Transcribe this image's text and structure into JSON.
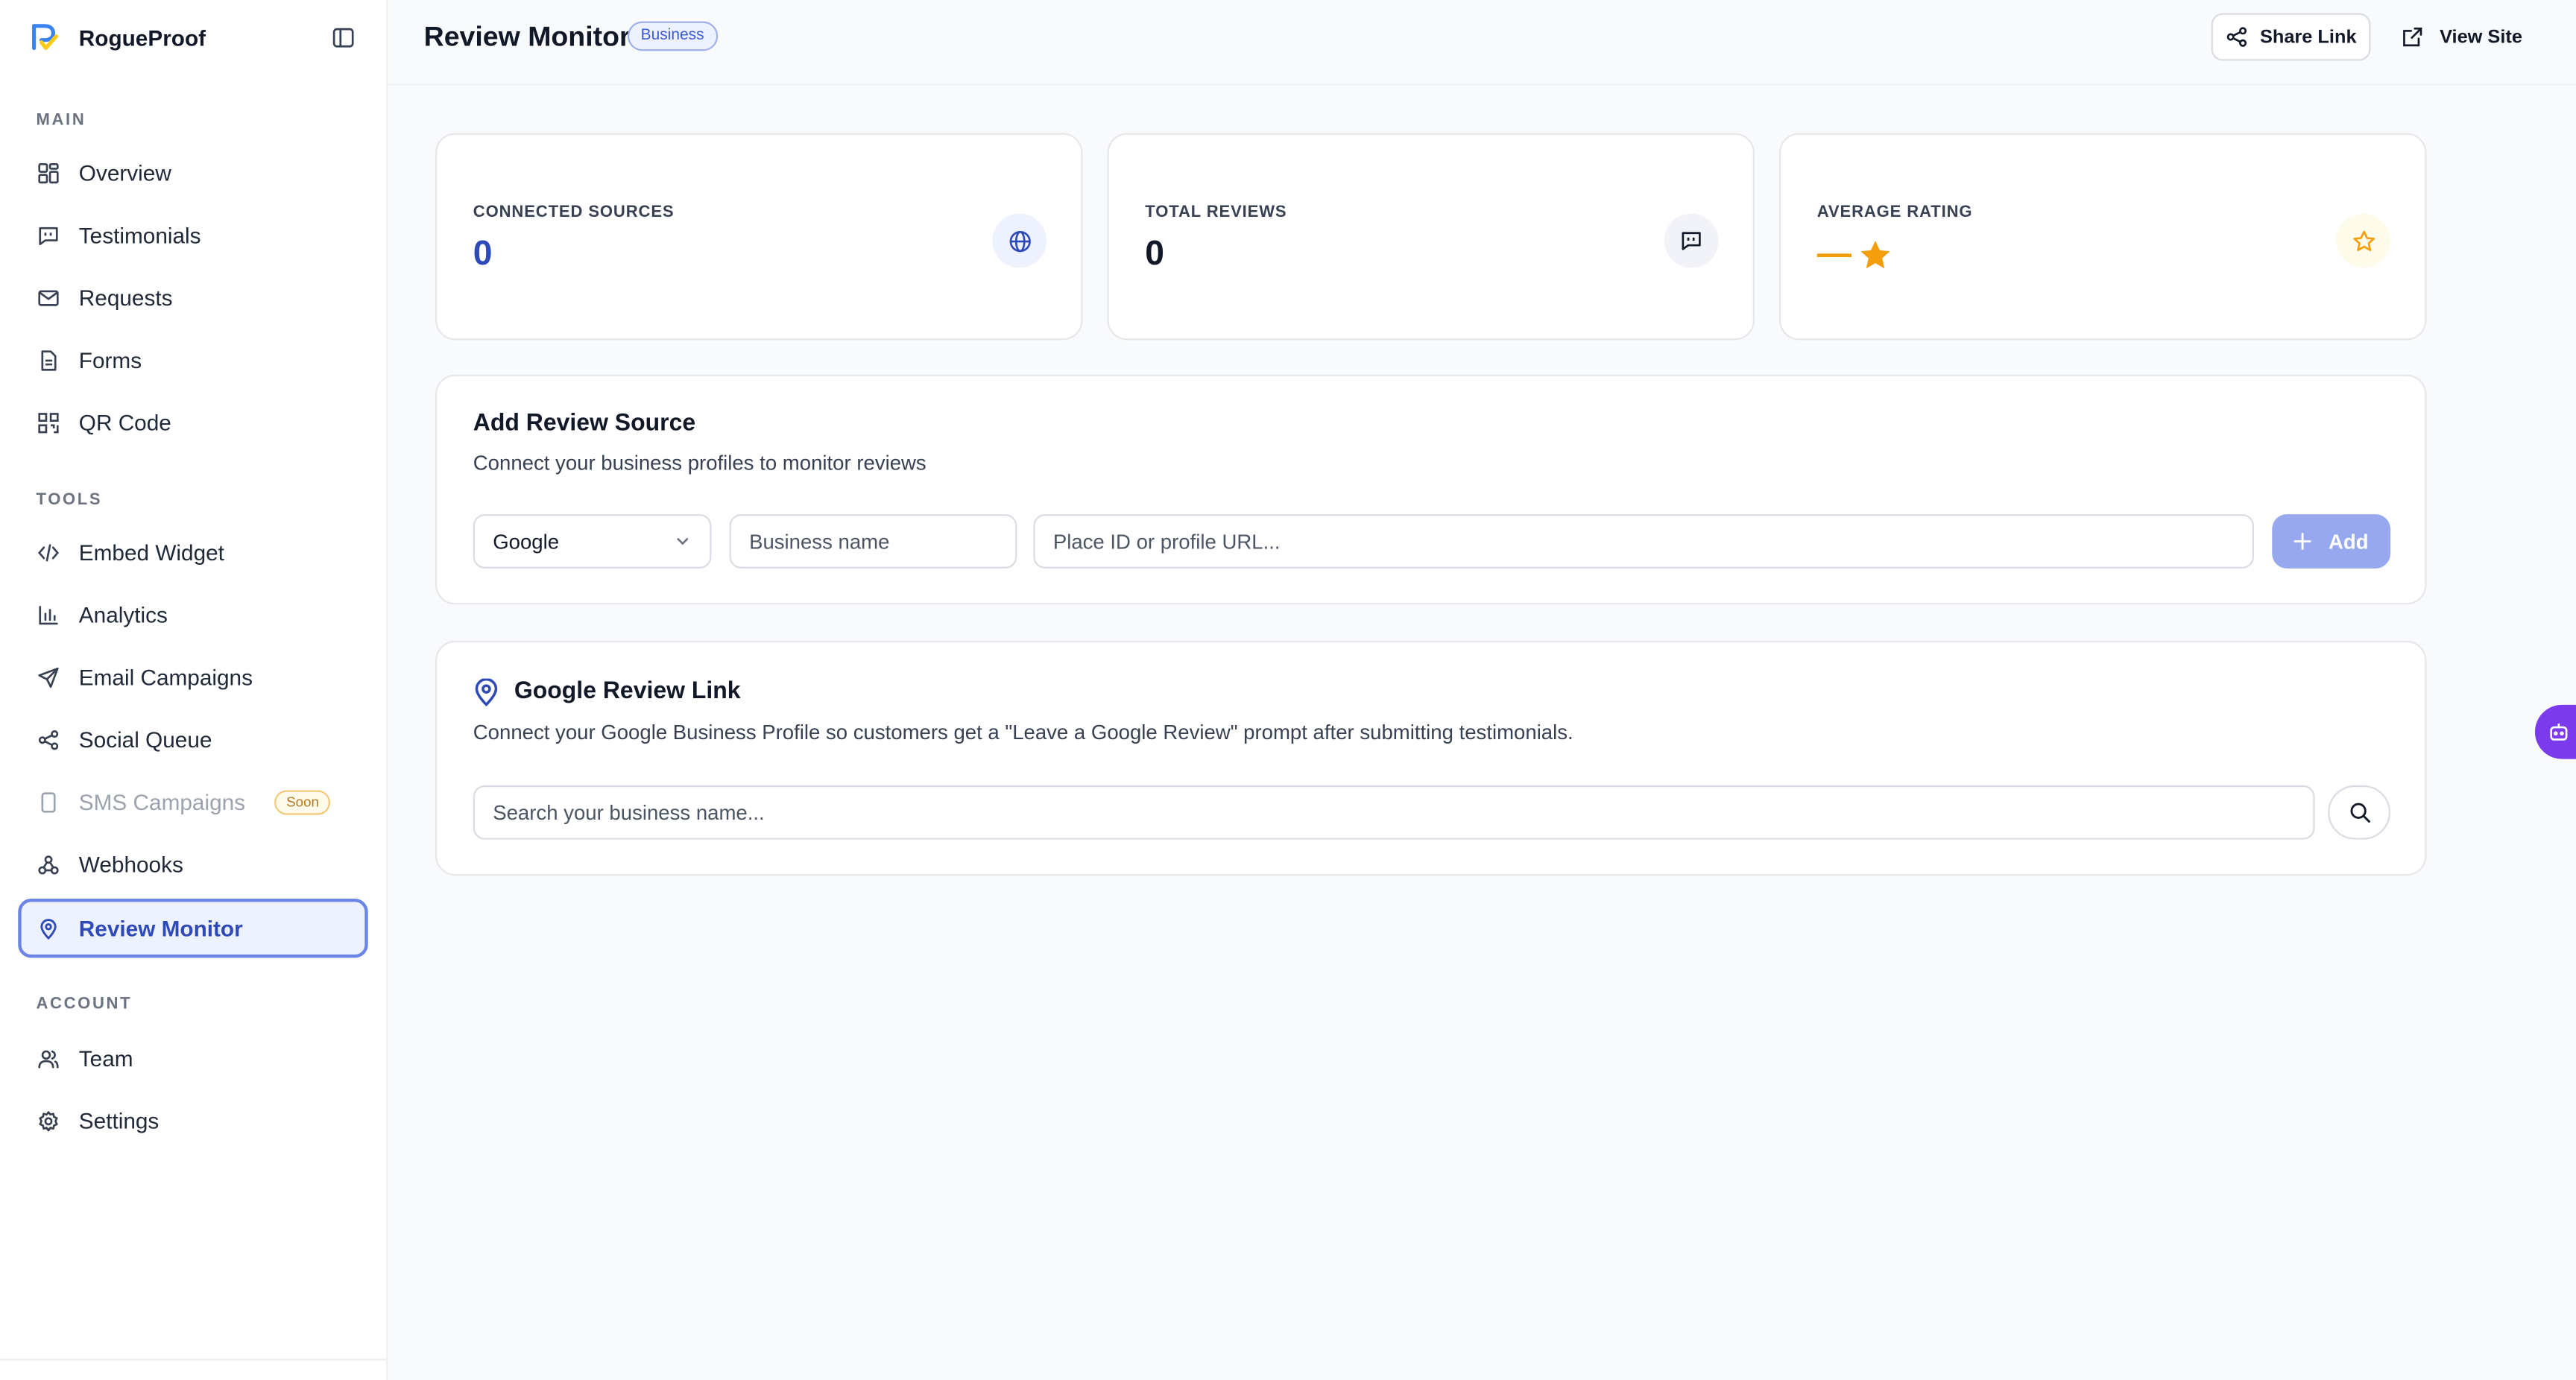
{
  "brand": {
    "name": "RogueProof"
  },
  "sidebar": {
    "sections": {
      "main": "MAIN",
      "tools": "TOOLS",
      "account": "ACCOUNT"
    },
    "items": {
      "overview": "Overview",
      "testimonials": "Testimonials",
      "requests": "Requests",
      "forms": "Forms",
      "qr_code": "QR Code",
      "embed_widget": "Embed Widget",
      "analytics": "Analytics",
      "email_campaigns": "Email Campaigns",
      "social_queue": "Social Queue",
      "sms_campaigns": "SMS Campaigns",
      "sms_badge": "Soon",
      "webhooks": "Webhooks",
      "review_monitor": "Review Monitor",
      "team": "Team",
      "settings": "Settings"
    },
    "active": "review_monitor"
  },
  "header": {
    "title": "Review Monitor",
    "plan_badge": "Business",
    "share_label": "Share Link",
    "view_label": "View Site"
  },
  "stats": {
    "connected": {
      "label": "CONNECTED SOURCES",
      "value": "0"
    },
    "total": {
      "label": "TOTAL REVIEWS",
      "value": "0"
    },
    "average": {
      "label": "AVERAGE RATING",
      "value": "—"
    }
  },
  "add_source": {
    "title": "Add Review Source",
    "subtitle": "Connect your business profiles to monitor reviews",
    "platform_selected": "Google",
    "business_placeholder": "Business name",
    "place_placeholder": "Place ID or profile URL...",
    "add_label": "Add"
  },
  "google_link": {
    "title": "Google Review Link",
    "subtitle": "Connect your Google Business Profile so customers get a \"Leave a Google Review\" prompt after submitting testimonials.",
    "search_placeholder": "Search your business name..."
  },
  "colors": {
    "accent": "#2e49b8",
    "accent_light": "#eef2ff",
    "star": "#f59e0b",
    "bot": "#7c3aed"
  }
}
